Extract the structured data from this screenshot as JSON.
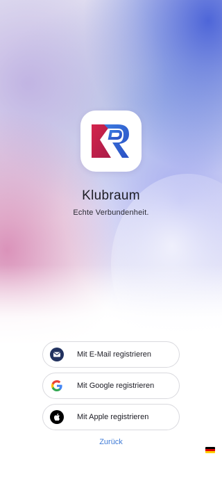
{
  "app": {
    "name": "Klubraum",
    "tagline": "Echte Verbundenheit.",
    "logo_icon": "klubraum-kr-logo"
  },
  "signup": {
    "email_label": "Mit E-Mail registrieren",
    "email_icon": "mail-icon",
    "google_label": "Mit Google registrieren",
    "google_icon": "google-icon",
    "apple_label": "Mit Apple registrieren",
    "apple_icon": "apple-icon"
  },
  "back_label": "Zurück",
  "language": {
    "flag_icon": "german-flag-icon",
    "flag_colors": [
      "#000000",
      "#dd0000",
      "#ffce00"
    ]
  },
  "colors": {
    "logo_red": "#c8234f",
    "logo_blue": "#2f64d6",
    "link_blue": "#3e7ad6",
    "email_icon_bg": "#22325f"
  }
}
